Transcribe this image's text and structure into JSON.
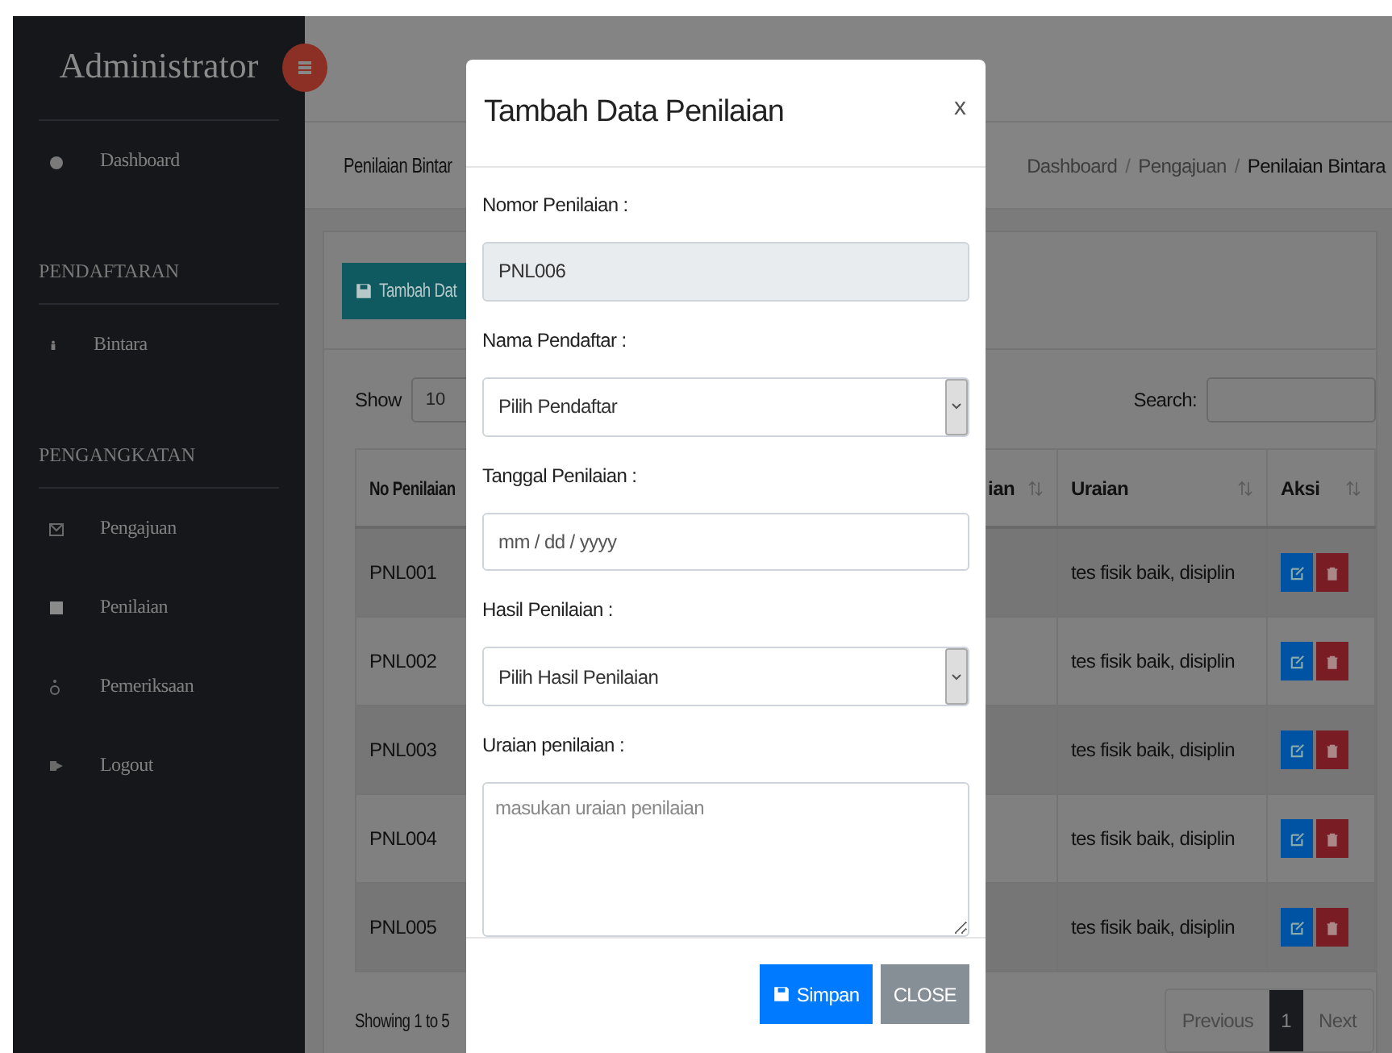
{
  "sidebar": {
    "brand": "Administrator",
    "items": [
      {
        "kind": "link",
        "label": "Dashboard"
      },
      {
        "kind": "section",
        "label": "PENDAFTARAN"
      },
      {
        "kind": "link",
        "label": "Bintara"
      },
      {
        "kind": "section",
        "label": "PENGANGKATAN"
      },
      {
        "kind": "link",
        "label": "Pengajuan"
      },
      {
        "kind": "link",
        "label": "Penilaian"
      },
      {
        "kind": "link",
        "label": "Pemeriksaan"
      },
      {
        "kind": "link",
        "label": "Logout"
      }
    ]
  },
  "page": {
    "title": "Penilaian Bintar",
    "breadcrumb": [
      "Dashboard",
      "Pengajuan",
      "Penilaian Bintara"
    ],
    "separator": "/"
  },
  "card": {
    "add_button": "Tambah Dat",
    "show_label": "Show",
    "page_size": "10",
    "search_label": "Search:"
  },
  "table": {
    "columns": [
      "No Penilaian",
      "ian",
      "Uraian",
      "Aksi"
    ],
    "rows": [
      {
        "no": "PNL001",
        "uraian": "tes fisik baik, disiplin"
      },
      {
        "no": "PNL002",
        "uraian": "tes fisik baik, disiplin"
      },
      {
        "no": "PNL003",
        "uraian": "tes fisik baik, disiplin"
      },
      {
        "no": "PNL004",
        "uraian": "tes fisik baik, disiplin"
      },
      {
        "no": "PNL005",
        "uraian": "tes fisik baik, disiplin"
      }
    ]
  },
  "footer": {
    "info": "Showing 1 to 5",
    "pages": [
      {
        "label": "Previous",
        "selected": false
      },
      {
        "label": "1",
        "selected": true
      },
      {
        "label": "Next",
        "selected": false
      }
    ]
  },
  "modal": {
    "title": "Tambah Data Penilaian",
    "close": "x",
    "fields": [
      {
        "kind": "readonly",
        "label": "Nomor Penilaian :",
        "value": "PNL006"
      },
      {
        "kind": "select",
        "label": "Nama Pendaftar :",
        "value": "Pilih Pendaftar"
      },
      {
        "kind": "date",
        "label": "Tanggal Penilaian :",
        "placeholder": "mm / dd / yyyy"
      },
      {
        "kind": "select",
        "label": "Hasil Penilaian :",
        "value": "Pilih Hasil Penilaian"
      },
      {
        "kind": "textarea",
        "label": "Uraian penilaian :",
        "placeholder": "masukan uraian penilaian"
      }
    ],
    "save": "Simpan",
    "cancel": "CLOSE"
  }
}
